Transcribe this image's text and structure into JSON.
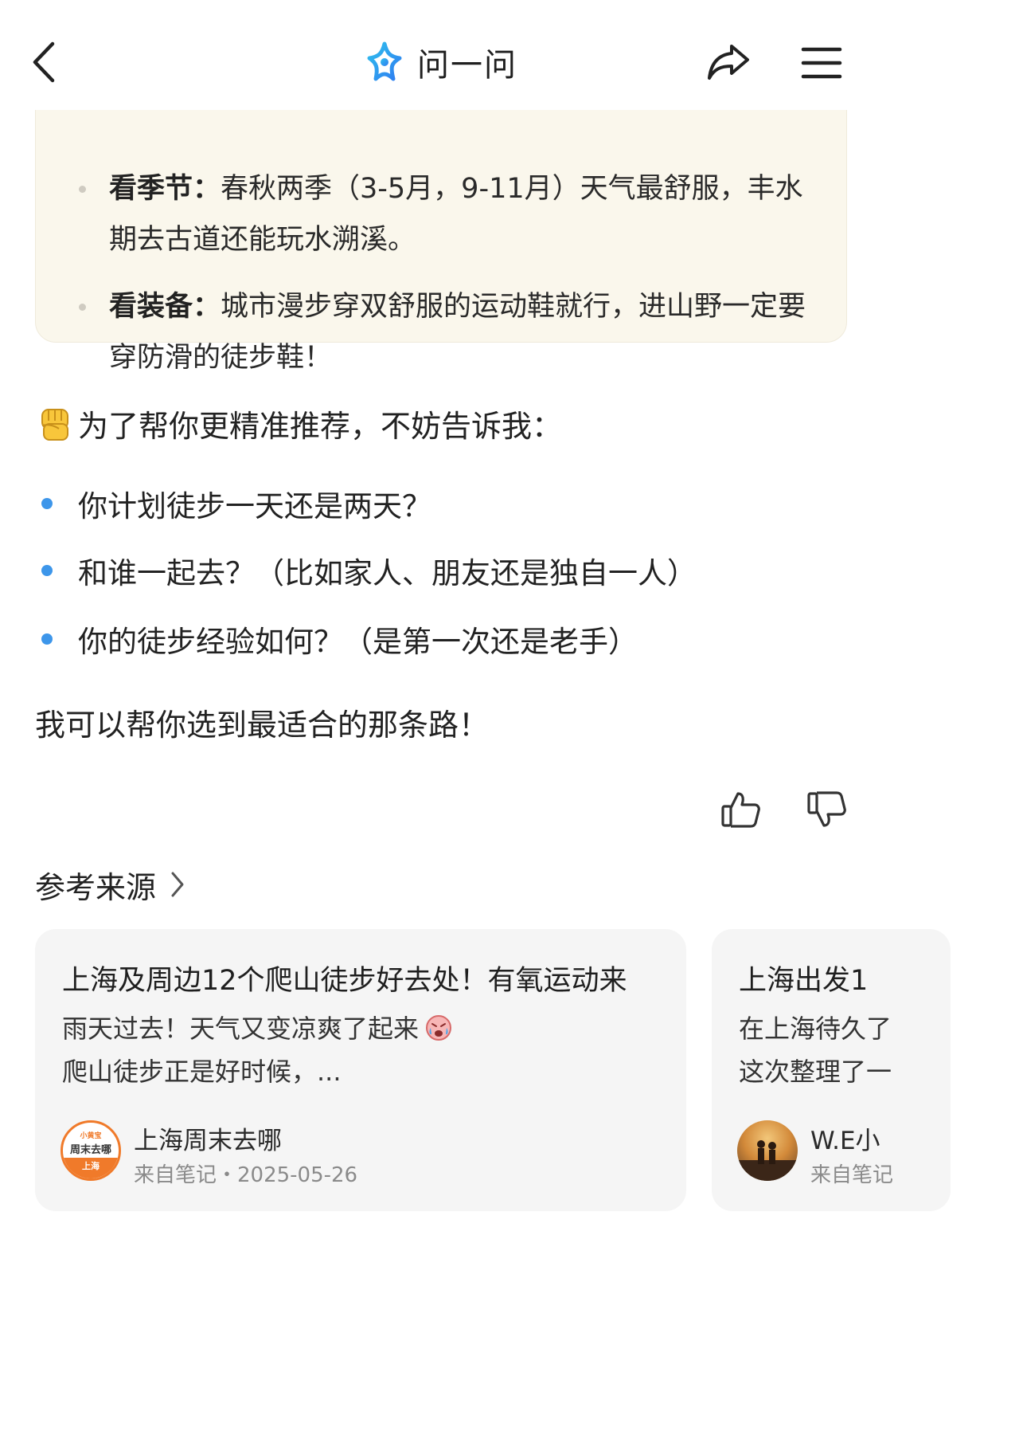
{
  "header": {
    "title": "问一问"
  },
  "tips": {
    "items": [
      {
        "key": "看季节：",
        "text": "春秋两季（3-5月，9-11月）天气最舒服，丰水期去古道还能玩水溯溪。"
      },
      {
        "key": "看装备：",
        "text": "城市漫步穿双舒服的运动鞋就行，进山野一定要穿防滑的徒步鞋！"
      }
    ]
  },
  "prompt": {
    "emoji": "✊",
    "intro": "为了帮你更精准推荐，不妨告诉我：",
    "questions": [
      "你计划徒步一天还是两天？",
      "和谁一起去？（比如家人、朋友还是独自一人）",
      "你的徒步经验如何？（是第一次还是老手）"
    ],
    "closing": "我可以帮你选到最适合的那条路！"
  },
  "sources": {
    "heading": "参考来源",
    "cards": [
      {
        "title": "上海及周边12个爬山徒步好去处！有氧运动来",
        "line1": "雨天过去！天气又变凉爽了起来",
        "line2": "爬山徒步正是好时候，...",
        "author": "上海周末去哪",
        "meta": "来自笔记・2025-05-26",
        "avatar_text_top": "小黄宝",
        "avatar_text_mid": "周末去哪",
        "avatar_text_bottom": "上海"
      },
      {
        "title": "上海出发1",
        "line1": "在上海待久了",
        "line2": "这次整理了一",
        "author": "W.E小",
        "meta": "来自笔记"
      }
    ]
  },
  "colors": {
    "accent_blue": "#3d96ea",
    "card_bg": "#faf7ec",
    "source_bg": "#f5f5f5",
    "avatar_orange": "#f07a2a"
  }
}
